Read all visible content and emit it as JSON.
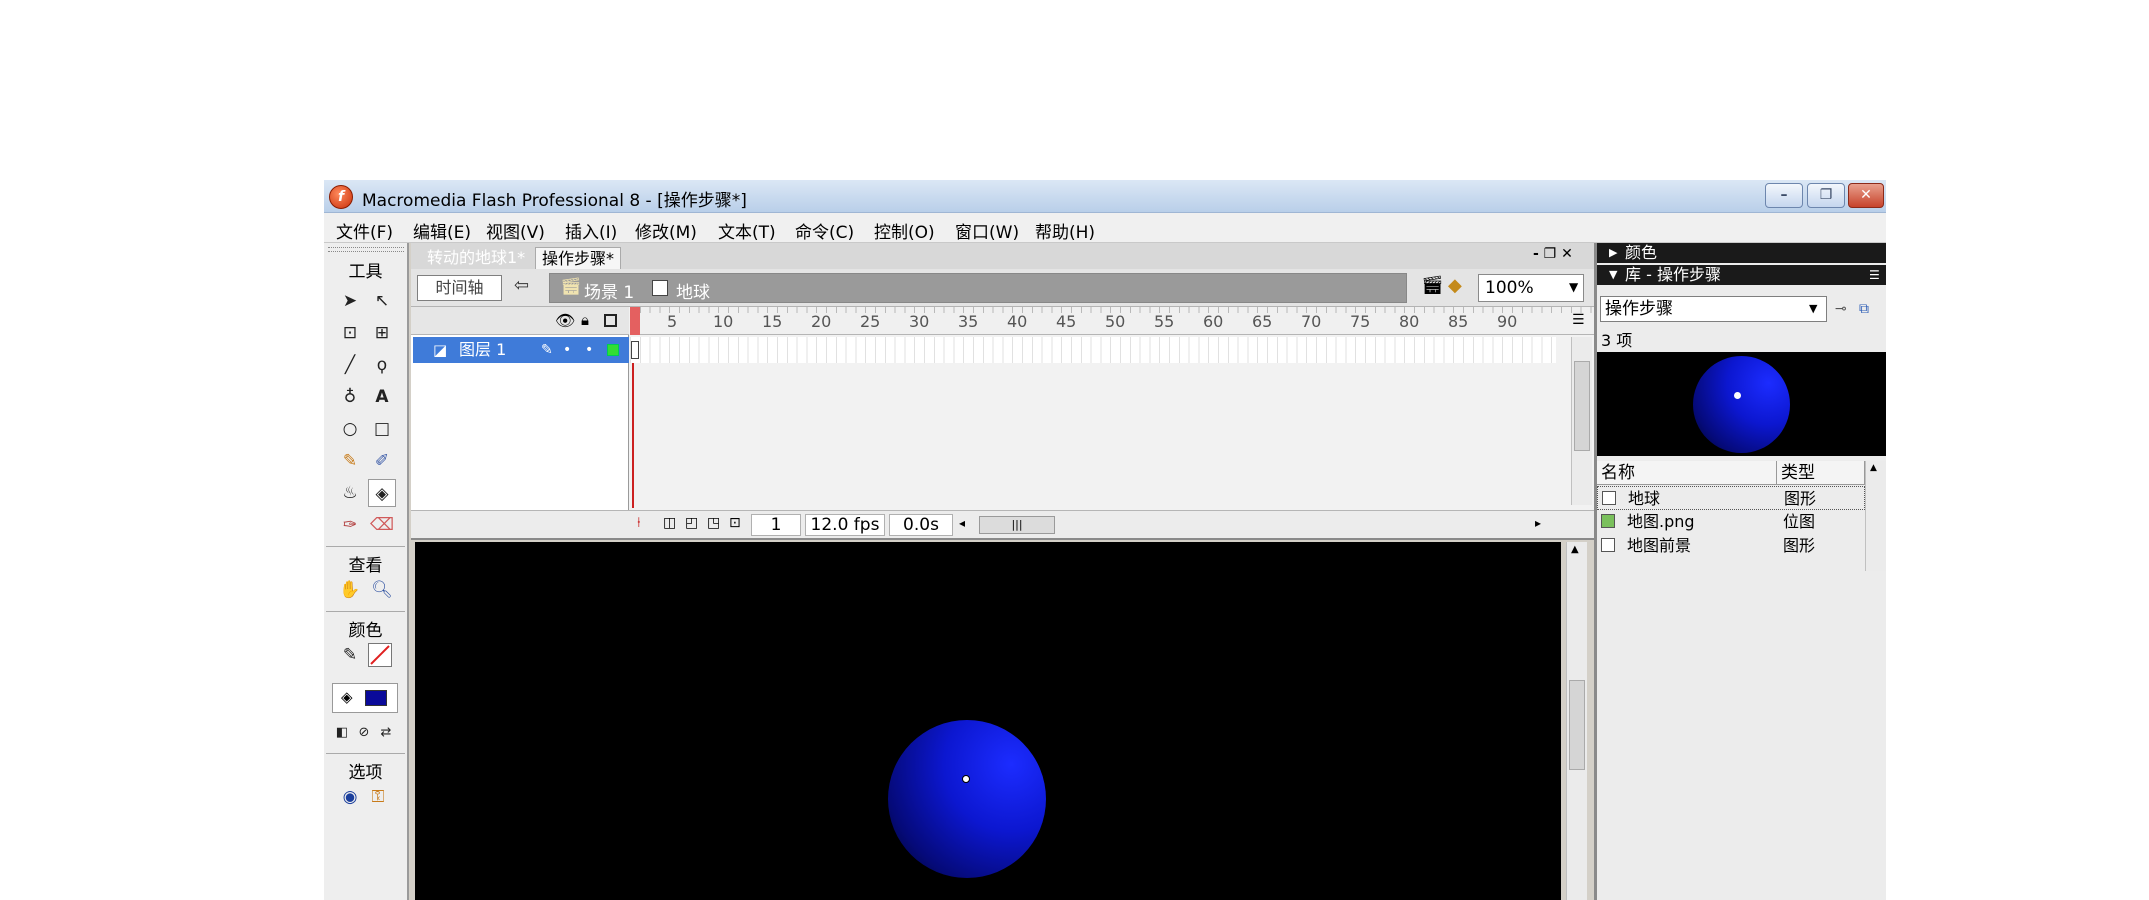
{
  "window": {
    "title": "Macromedia Flash Professional 8 - [操作步骤*]",
    "app_icon_glyph": "f",
    "buttons": {
      "minimize": "–",
      "restore": "❐",
      "close": "✕"
    }
  },
  "menu": [
    "文件(F)",
    "编辑(E)",
    "视图(V)",
    "插入(I)",
    "修改(M)",
    "文本(T)",
    "命令(C)",
    "控制(O)",
    "窗口(W)",
    "帮助(H)"
  ],
  "tools": {
    "title": "工具",
    "view_title": "查看",
    "color_title": "颜色",
    "options_title": "选项"
  },
  "document": {
    "tabs": [
      {
        "label": "转动的地球1*",
        "active": false
      },
      {
        "label": "操作步骤*",
        "active": true
      }
    ],
    "window_controls": "‑ ❐ ✕",
    "timeline_button": "时间轴",
    "breadcrumb": {
      "scene": "场景 1",
      "symbol": "地球"
    },
    "zoom": "100%"
  },
  "timeline": {
    "frame_numbers": [
      "5",
      "10",
      "15",
      "20",
      "25",
      "30",
      "35",
      "40",
      "45",
      "50",
      "55",
      "60",
      "65",
      "70",
      "75",
      "80",
      "85",
      "90"
    ],
    "layer_name": "图层 1",
    "current_frame": "1",
    "fps": "12.0 fps",
    "elapsed": "0.0s"
  },
  "library": {
    "color_panel_title": "颜色",
    "title": "库 - 操作步骤",
    "selected_doc": "操作步骤",
    "item_count": "3 项",
    "columns": {
      "name": "名称",
      "type": "类型"
    },
    "items": [
      {
        "name": "地球",
        "type": "图形"
      },
      {
        "name": "地图.png",
        "type": "位图"
      },
      {
        "name": "地图前景",
        "type": "图形"
      }
    ]
  },
  "colors": {
    "stage_bg": "#000000",
    "globe": "#1422f0",
    "layer_highlight": "#3f7bd9",
    "playhead": "#e46060"
  }
}
